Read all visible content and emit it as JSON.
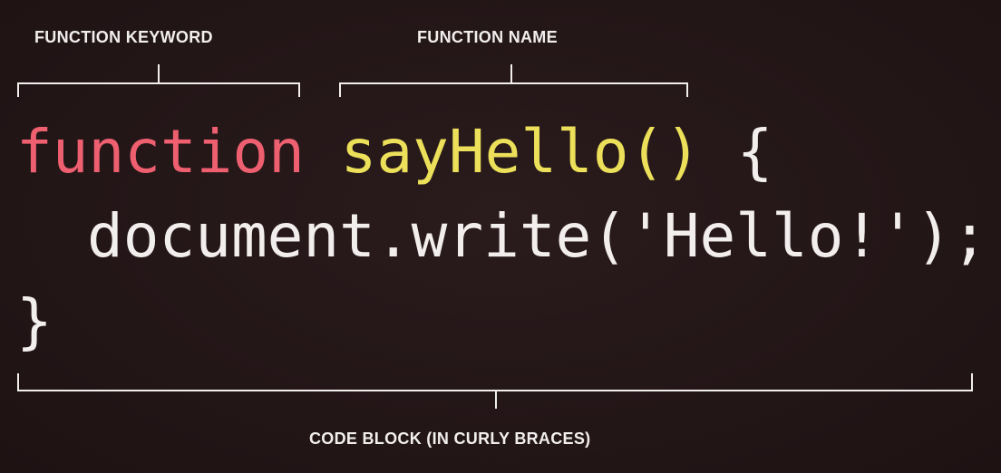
{
  "labels": {
    "function_keyword": "FUNCTION KEYWORD",
    "function_name": "FUNCTION NAME",
    "code_block": "CODE BLOCK (IN CURLY BRACES)"
  },
  "code": {
    "keyword": "function",
    "name": "sayHello()",
    "open_brace": "{",
    "body_line": "document.write('Hello!');",
    "close_brace": "}"
  },
  "colors": {
    "background": "#231617",
    "keyword": "#ee5f70",
    "function_name": "#ece05a",
    "plain_text": "#f3eeee",
    "annotation": "#f2eeee"
  }
}
